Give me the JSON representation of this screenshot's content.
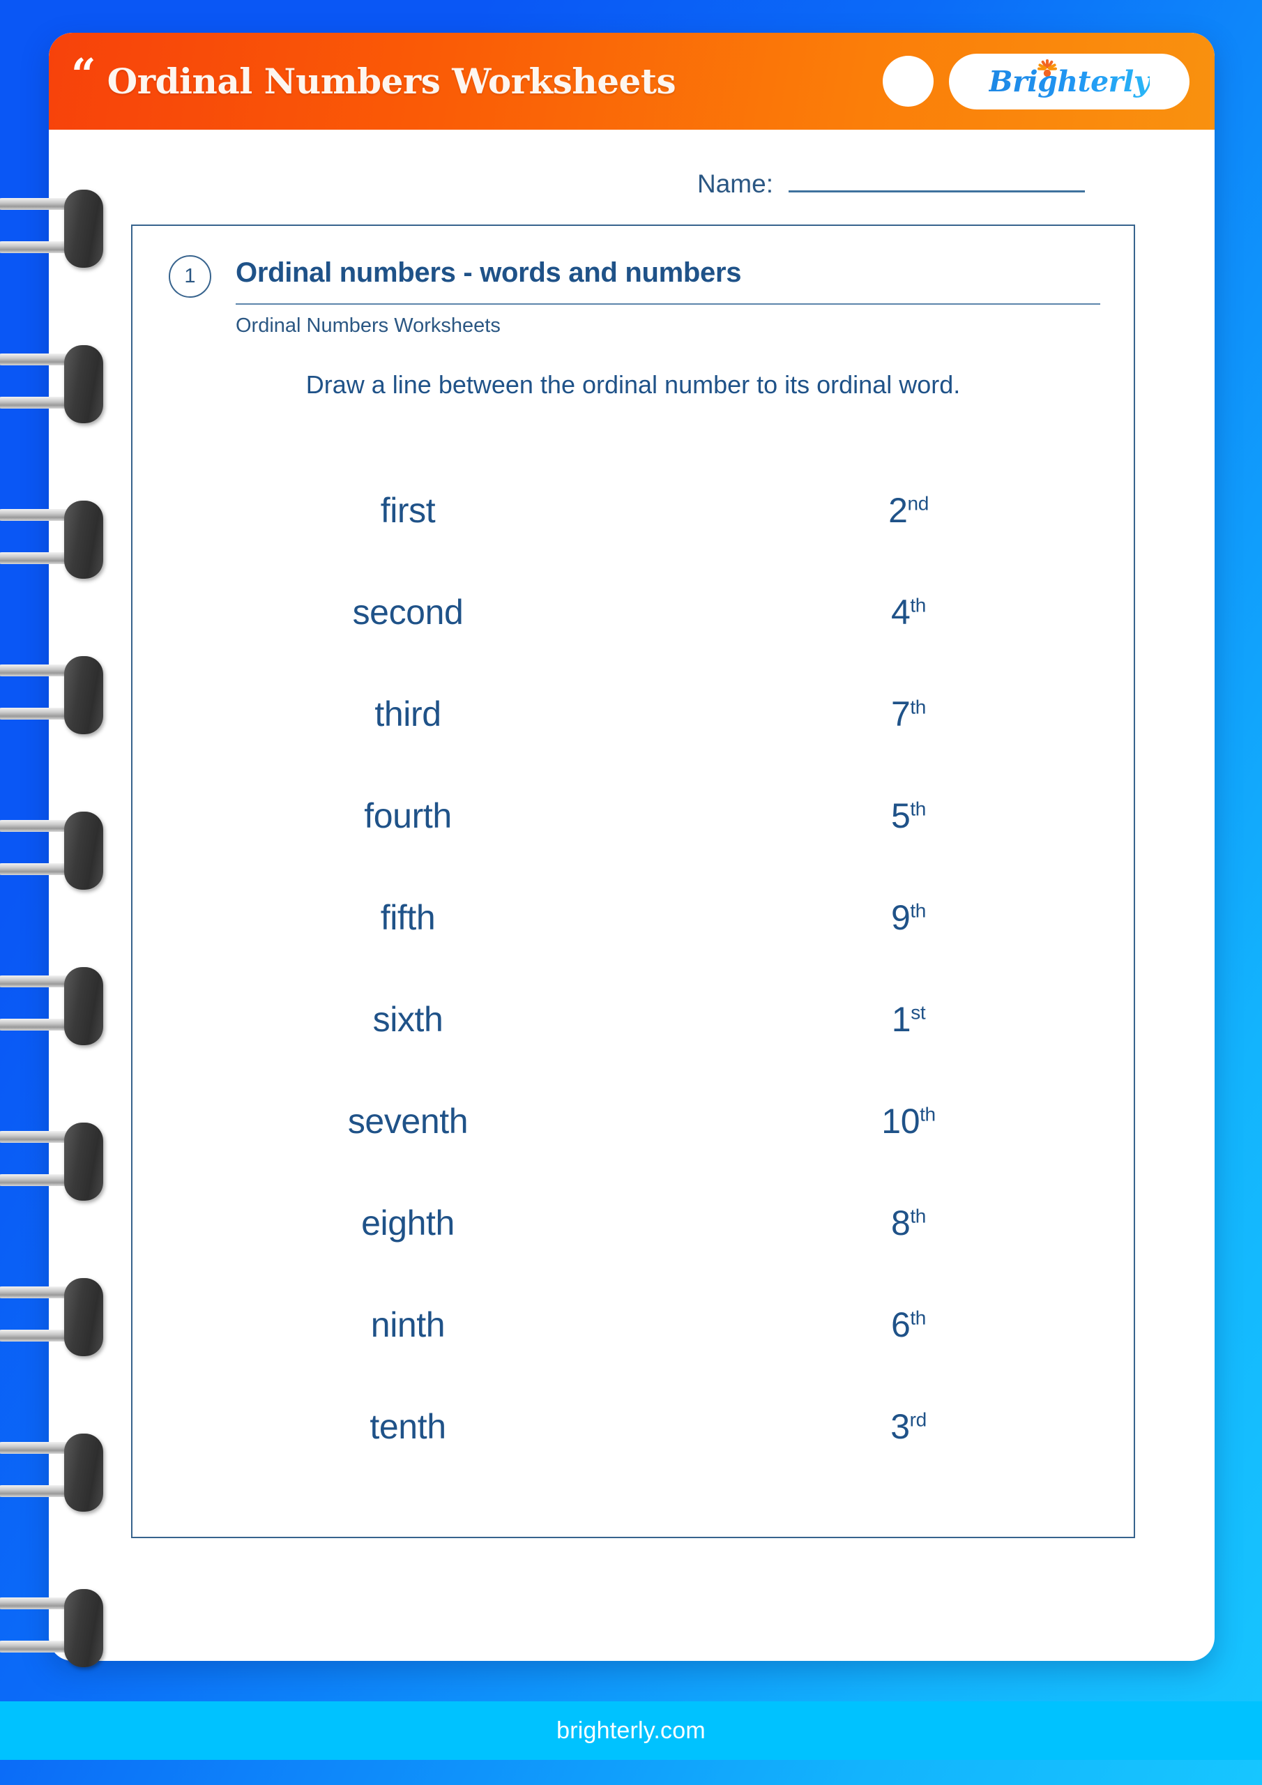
{
  "header": {
    "quote_glyph": "“",
    "title": "Ordinal Numbers Worksheets",
    "logo_text": "Brighterly",
    "logo_icon": "sunburst-icon",
    "colors": {
      "gradient_start": "#f7420b",
      "gradient_end": "#f9910f",
      "logo_blue": "#2196f3",
      "logo_orange": "#f9690e"
    }
  },
  "name_field": {
    "label": "Name:",
    "value": ""
  },
  "exercise": {
    "number": "1",
    "title": "Ordinal numbers - words and numbers",
    "subtitle": "Ordinal Numbers Worksheets",
    "instruction": "Draw a line between the ordinal number to its ordinal word."
  },
  "matching": {
    "rows": [
      {
        "word": "first",
        "numeral": "2",
        "suffix": "nd"
      },
      {
        "word": "second",
        "numeral": "4",
        "suffix": "th"
      },
      {
        "word": "third",
        "numeral": "7",
        "suffix": "th"
      },
      {
        "word": "fourth",
        "numeral": "5",
        "suffix": "th"
      },
      {
        "word": "fifth",
        "numeral": "9",
        "suffix": "th"
      },
      {
        "word": "sixth",
        "numeral": "1",
        "suffix": "st"
      },
      {
        "word": "seventh",
        "numeral": "10",
        "suffix": "th"
      },
      {
        "word": "eighth",
        "numeral": "8",
        "suffix": "th"
      },
      {
        "word": "ninth",
        "numeral": "6",
        "suffix": "th"
      },
      {
        "word": "tenth",
        "numeral": "3",
        "suffix": "rd"
      }
    ]
  },
  "footer": {
    "url": "brighterly.com"
  },
  "theme": {
    "background_blue": "#0a57f5",
    "background_cyan": "#17c6ff",
    "ink_blue": "#1f5288",
    "footer_band": "#00c2ff"
  }
}
